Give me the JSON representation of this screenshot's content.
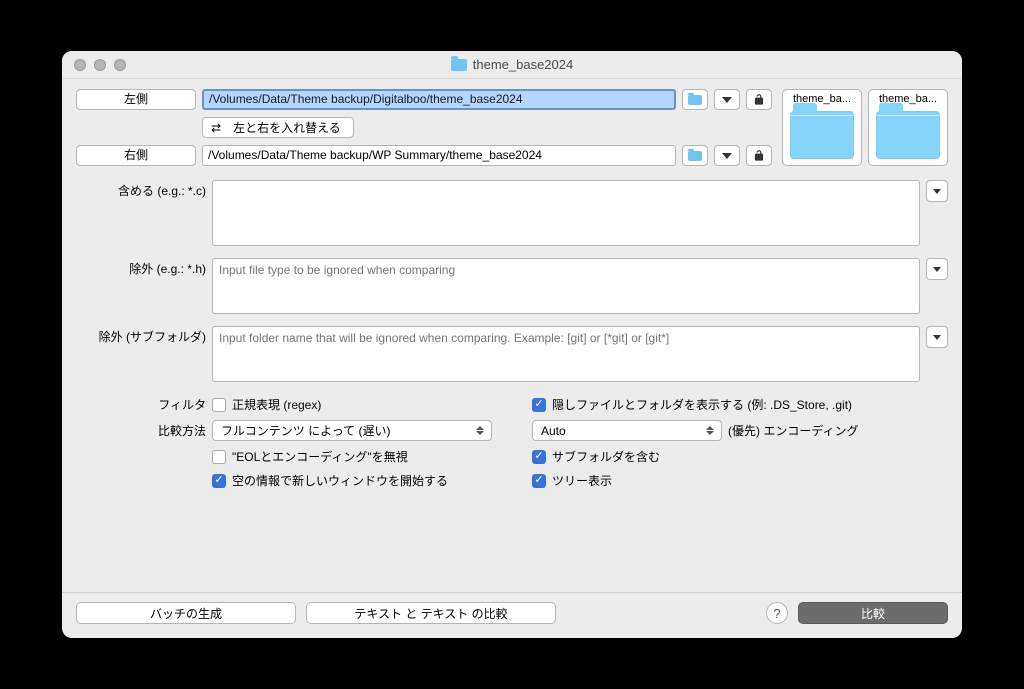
{
  "window": {
    "title": "theme_base2024"
  },
  "paths": {
    "left_label": "左側",
    "right_label": "右側",
    "left_value": "/Volumes/Data/Theme backup/Digitalboo/theme_base2024",
    "right_value": "/Volumes/Data/Theme backup/WP Summary/theme_base2024",
    "swap_label": "左と右を入れ替える"
  },
  "previews": {
    "left_name": "theme_ba...",
    "right_name": "theme_ba..."
  },
  "filters": {
    "include_label": "含める (e.g.: *.c)",
    "exclude_label": "除外 (e.g.: *.h)",
    "exclude_placeholder": "Input file type to be ignored when comparing",
    "exclude_sub_label": "除外 (サブフォルダ)",
    "exclude_sub_placeholder": "Input folder name that will be ignored when comparing. Example: [git] or [*git] or [git*]"
  },
  "options": {
    "filter_label": "フィルタ",
    "regex_label": "正規表現 (regex)",
    "compare_method_label": "比較方法",
    "compare_method_value": "フルコンテンツ によって (遅い)",
    "ignore_eol_label": "\"EOLとエンコーディング\"を無視",
    "new_window_label": "空の情報で新しいウィンドウを開始する",
    "show_hidden_label": "隠しファイルとフォルダを表示する (例: .DS_Store, .git)",
    "encoding_value": "Auto",
    "encoding_suffix": "(優先) エンコーディング",
    "include_sub_label": "サブフォルダを含む",
    "tree_view_label": "ツリー表示"
  },
  "bottom": {
    "batch_label": "バッチの生成",
    "text_compare_label": "テキスト と テキスト の比較",
    "help_glyph": "?",
    "compare_label": "比較"
  }
}
